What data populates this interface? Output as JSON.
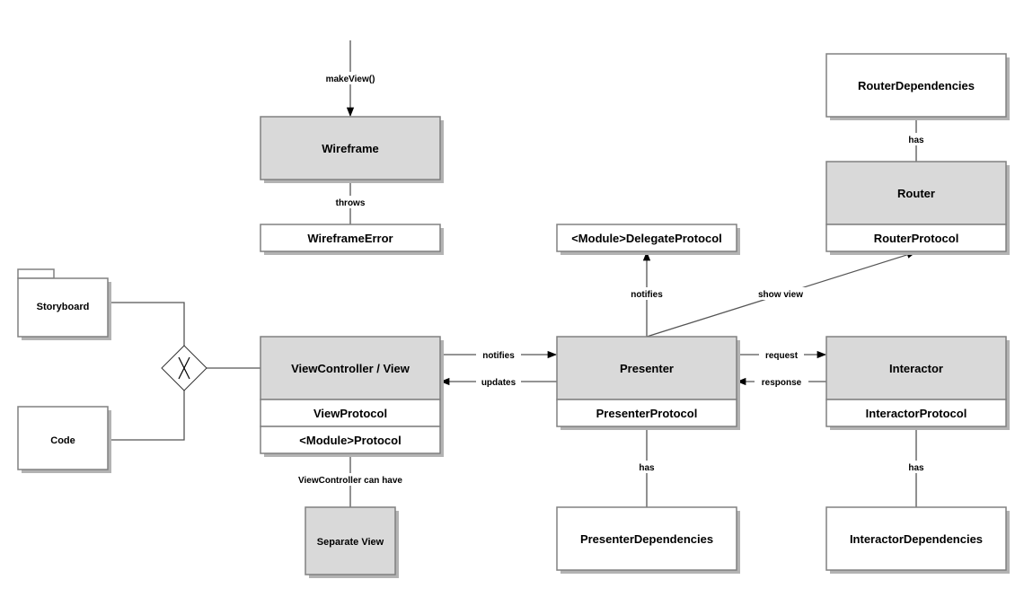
{
  "colors": {
    "header_fill": "#d9d9d9",
    "box_fill": "#ffffff",
    "stroke": "#808080",
    "shadow": "#b3b3b3",
    "line": "#555555"
  },
  "boxes": {
    "wireframe": {
      "title": "Wireframe",
      "sections": []
    },
    "wireframe_error": {
      "title": "WireframeError"
    },
    "router_dependencies": {
      "title": "RouterDependencies"
    },
    "router": {
      "title": "Router",
      "sections": [
        "RouterProtocol"
      ]
    },
    "delegate_protocol": {
      "title": "<Module>DelegateProtocol"
    },
    "storyboard": {
      "title": "Storyboard"
    },
    "code": {
      "title": "Code"
    },
    "view_controller": {
      "title": "ViewController / View",
      "sections": [
        "ViewProtocol",
        "<Module>Protocol"
      ]
    },
    "presenter": {
      "title": "Presenter",
      "sections": [
        "PresenterProtocol"
      ]
    },
    "interactor": {
      "title": "Interactor",
      "sections": [
        "InteractorProtocol"
      ]
    },
    "separate_view": {
      "title": "Separate View"
    },
    "presenter_dependencies": {
      "title": "PresenterDependencies"
    },
    "interactor_dependencies": {
      "title": "InteractorDependencies"
    }
  },
  "edges": {
    "make_view": "makeView()",
    "throws": "throws",
    "router_has": "has",
    "presenter_notifies_delegate": "notifies",
    "show_view": "show view",
    "view_notifies": "notifies",
    "presenter_updates": "updates",
    "request": "request",
    "response": "response",
    "presenter_has": "has",
    "interactor_has": "has",
    "vc_can_have": "ViewController can have"
  }
}
